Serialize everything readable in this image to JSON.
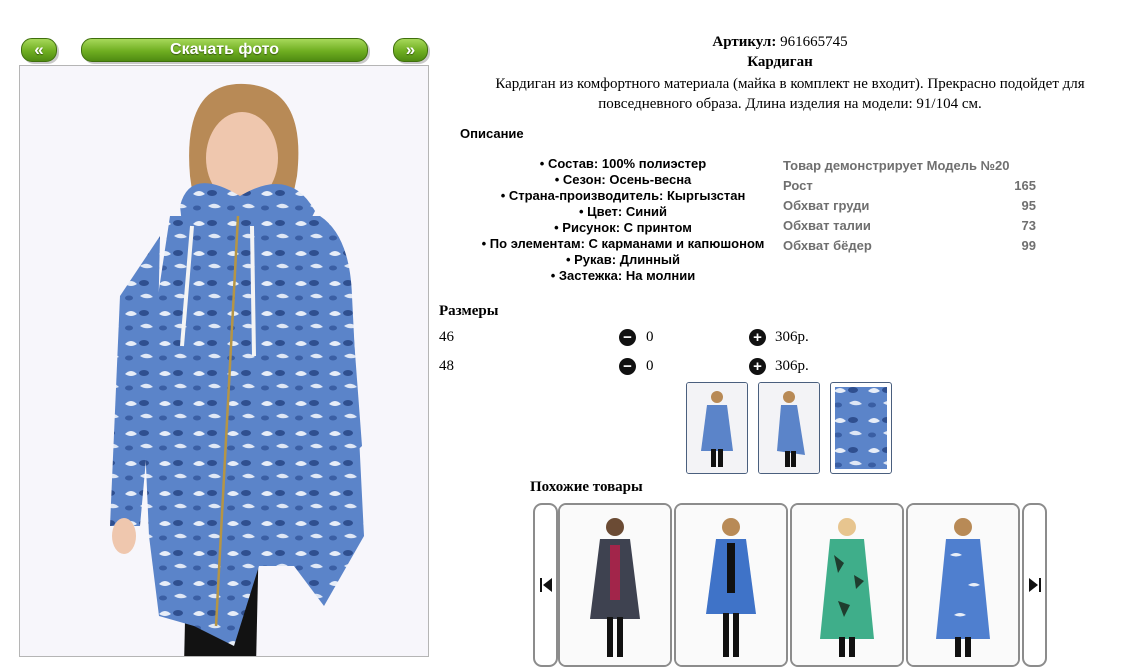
{
  "nav": {
    "prev_label": "«",
    "download_label": "Скачать фото",
    "next_label": "»"
  },
  "product": {
    "article_label": "Артикул:",
    "article_value": "961665745",
    "name": "Кардиган",
    "description": "Кардиган из комфортного материала (майка в комплект не входит). Прекрасно подойдет для повседневного образа. Длина изделия на модели: 91/104 см.",
    "description_heading": "Описание",
    "attributes": [
      "• Состав: 100% полиэстер",
      "• Сезон: Осень-весна",
      "• Страна-производитель: Кыргызстан",
      "• Цвет: Синий",
      "• Рисунок: С принтом",
      "• По элементам: С карманами и капюшоном",
      "• Рукав: Длинный",
      "• Застежка: На молнии"
    ]
  },
  "model": {
    "header": "Товар демонстрирует Модель №20",
    "rows": [
      {
        "label": "Рост",
        "value": "165"
      },
      {
        "label": "Обхват груди",
        "value": "95"
      },
      {
        "label": "Обхват талии",
        "value": "73"
      },
      {
        "label": "Обхват бёдер",
        "value": "99"
      }
    ]
  },
  "sizes": {
    "heading": "Размеры",
    "rows": [
      {
        "size": "46",
        "qty": "0",
        "price": "306р."
      },
      {
        "size": "48",
        "qty": "0",
        "price": "306р."
      }
    ]
  },
  "similar": {
    "heading": "Похожие товары"
  },
  "icons": {
    "minus": "minus-circle-icon",
    "plus": "plus-circle-icon",
    "carousel_prev": "skip-back-icon",
    "carousel_next": "skip-forward-icon"
  },
  "colors": {
    "button_green": "#6fae21",
    "cardigan_blue": "#5b84c9",
    "muted_text": "#6f6f6f"
  }
}
